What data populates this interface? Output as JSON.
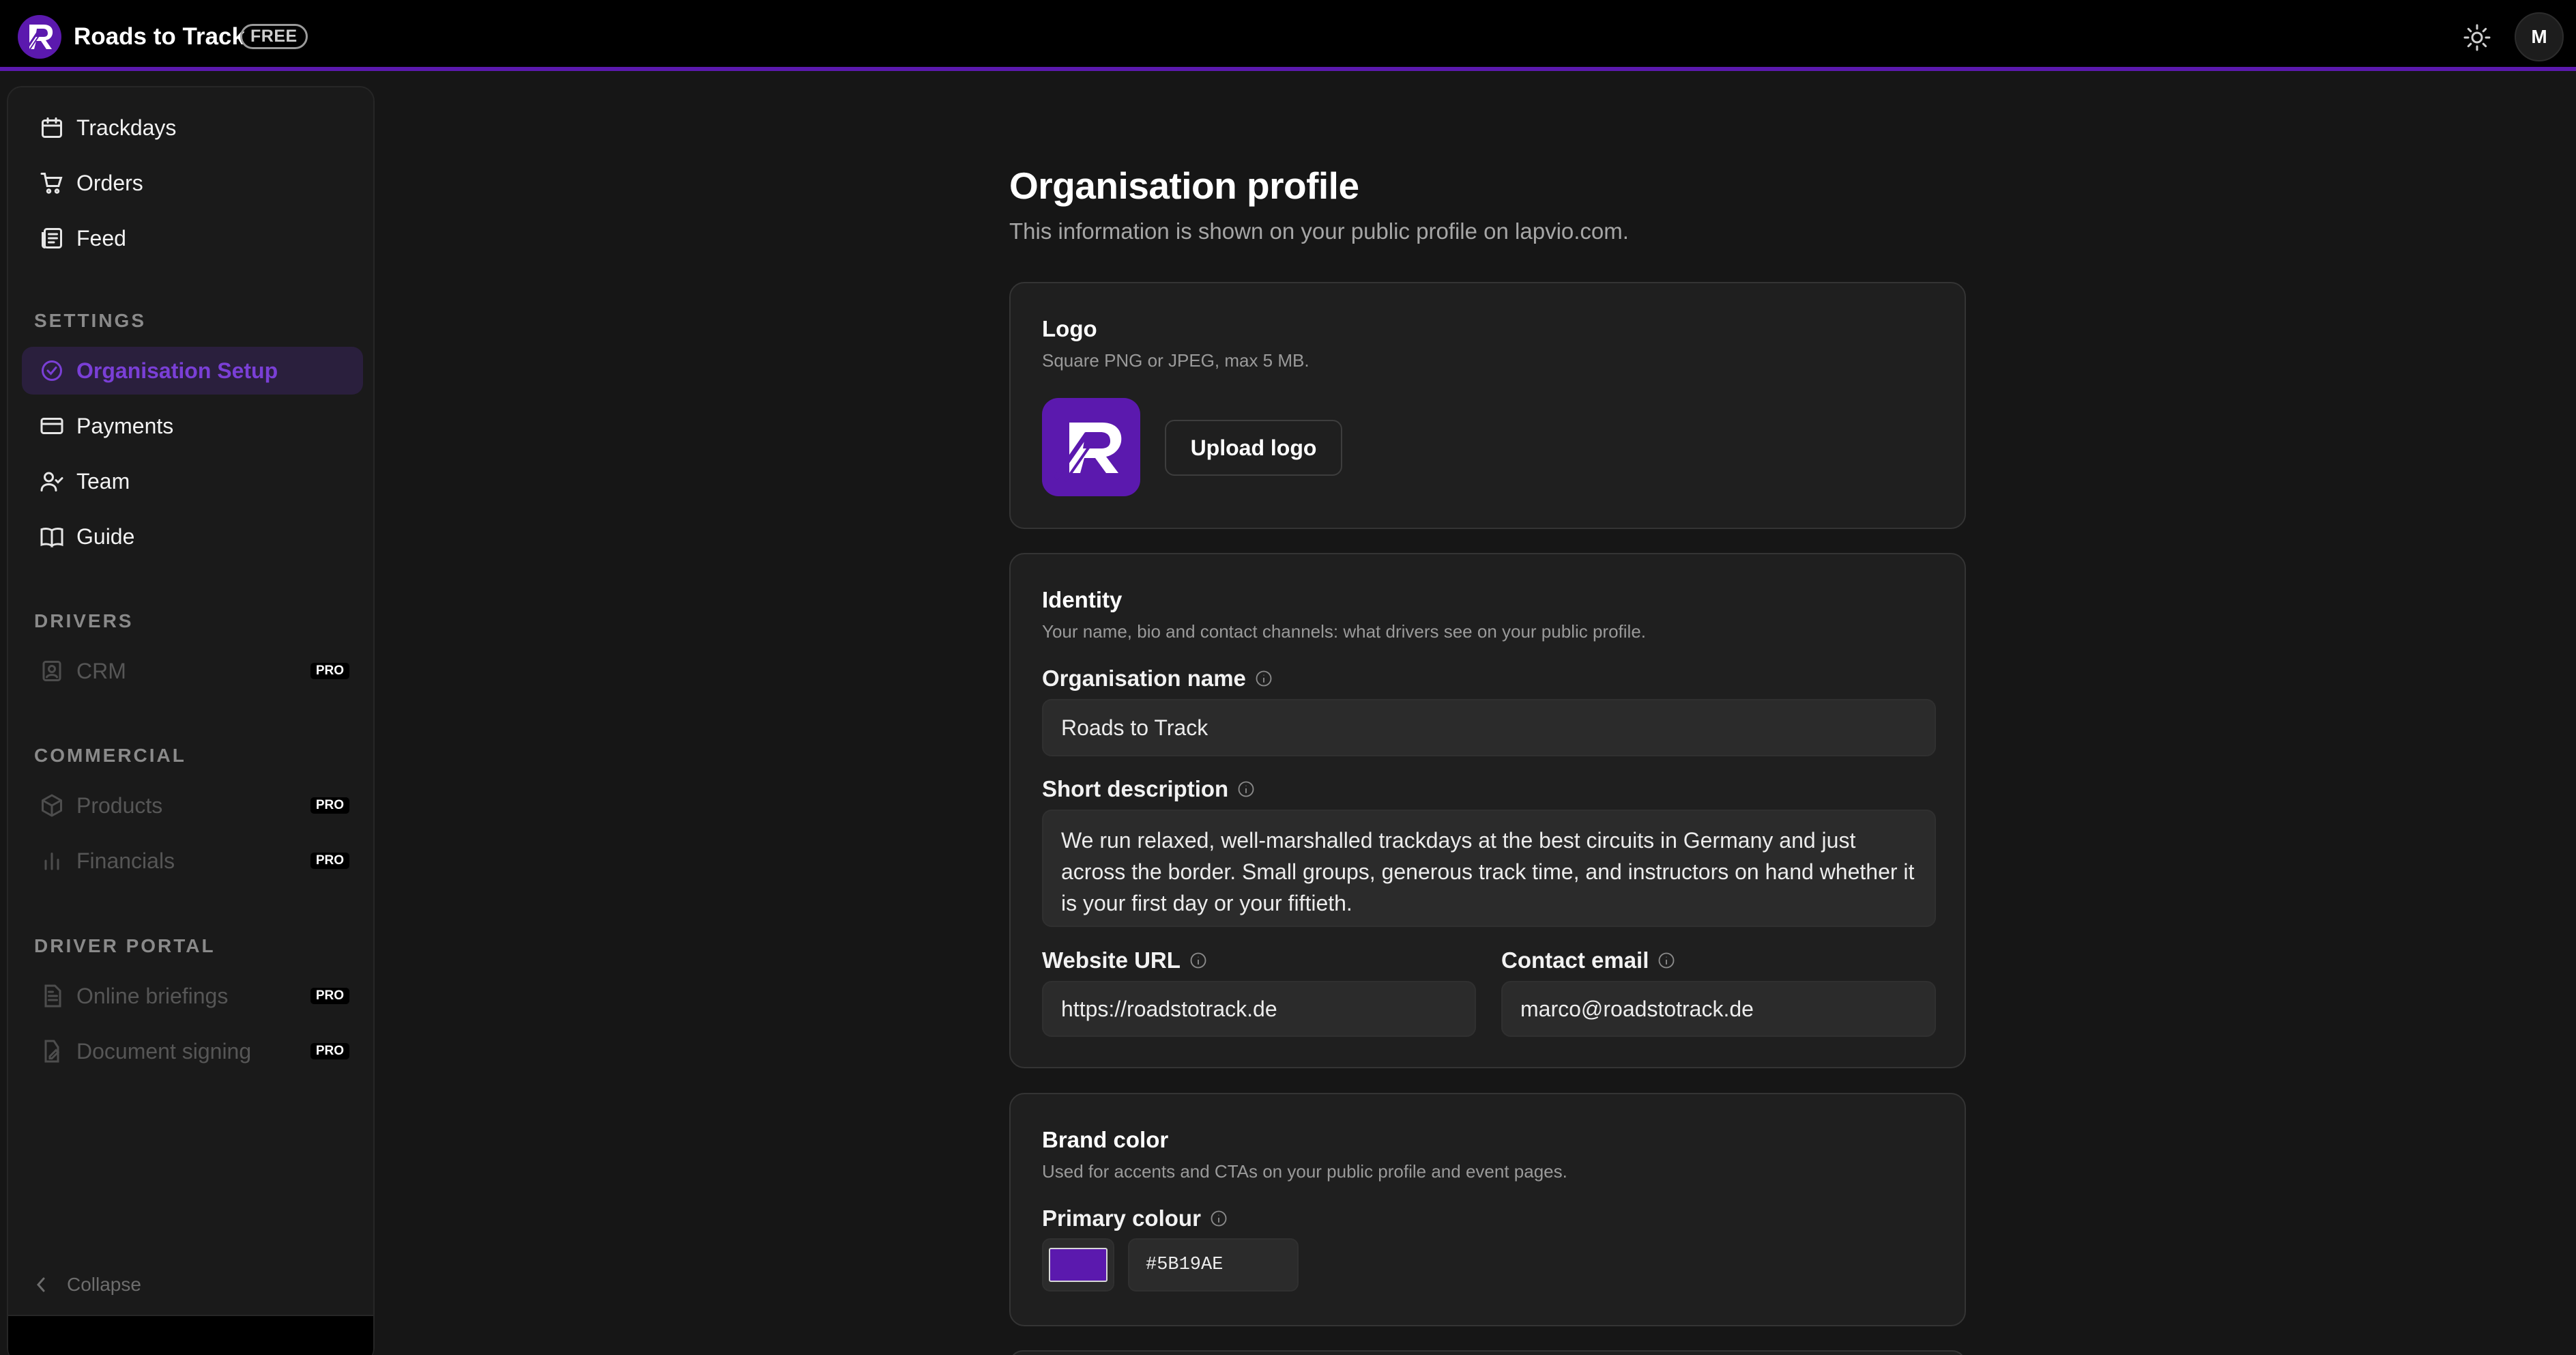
{
  "header": {
    "app_name": "Roads to Track",
    "plan_badge": "FREE",
    "avatar_initial": "M"
  },
  "sidebar": {
    "main_items": [
      {
        "label": "Trackdays",
        "icon": "calendar-icon"
      },
      {
        "label": "Orders",
        "icon": "cart-icon"
      },
      {
        "label": "Feed",
        "icon": "newspaper-icon"
      }
    ],
    "settings_heading": "SETTINGS",
    "settings_items": [
      {
        "label": "Organisation Setup",
        "icon": "check-circle-icon",
        "active": true
      },
      {
        "label": "Payments",
        "icon": "credit-card-icon"
      },
      {
        "label": "Team",
        "icon": "users-icon"
      },
      {
        "label": "Guide",
        "icon": "book-icon"
      }
    ],
    "drivers_heading": "DRIVERS",
    "drivers_items": [
      {
        "label": "CRM",
        "icon": "contact-icon",
        "badge": "PRO",
        "disabled": true
      }
    ],
    "commercial_heading": "COMMERCIAL",
    "commercial_items": [
      {
        "label": "Products",
        "icon": "package-icon",
        "badge": "PRO",
        "disabled": true
      },
      {
        "label": "Financials",
        "icon": "bar-chart-icon",
        "badge": "PRO",
        "disabled": true
      }
    ],
    "portal_heading": "DRIVER PORTAL",
    "portal_items": [
      {
        "label": "Online briefings",
        "icon": "file-text-icon",
        "badge": "PRO",
        "disabled": true
      },
      {
        "label": "Document signing",
        "icon": "file-signature-icon",
        "badge": "PRO",
        "disabled": true
      }
    ],
    "collapse_label": "Collapse"
  },
  "main": {
    "title": "Organisation profile",
    "subtitle": "This information is shown on your public profile on lapvio.com.",
    "logo_card": {
      "title": "Logo",
      "subtitle": "Square PNG or JPEG, max 5 MB.",
      "upload_label": "Upload logo"
    },
    "identity_card": {
      "title": "Identity",
      "subtitle": "Your name, bio and contact channels: what drivers see on your public profile.",
      "org_name_label": "Organisation name",
      "org_name_value": "Roads to Track",
      "short_desc_label": "Short description",
      "short_desc_value": "We run relaxed, well-marshalled trackdays at the best circuits in Germany and just across the border. Small groups, generous track time, and instructors on hand whether it is your first day or your fiftieth.",
      "website_label": "Website URL",
      "website_value": "https://roadstotrack.de",
      "email_label": "Contact email",
      "email_value": "marco@roadstotrack.de"
    },
    "brand_card": {
      "title": "Brand color",
      "subtitle": "Used for accents and CTAs on your public profile and event pages.",
      "primary_label": "Primary colour",
      "primary_value": "#5B19AE"
    }
  },
  "colors": {
    "brand": "#5B19AE",
    "active_nav_text": "#7A3FD6",
    "background": "#161616"
  }
}
